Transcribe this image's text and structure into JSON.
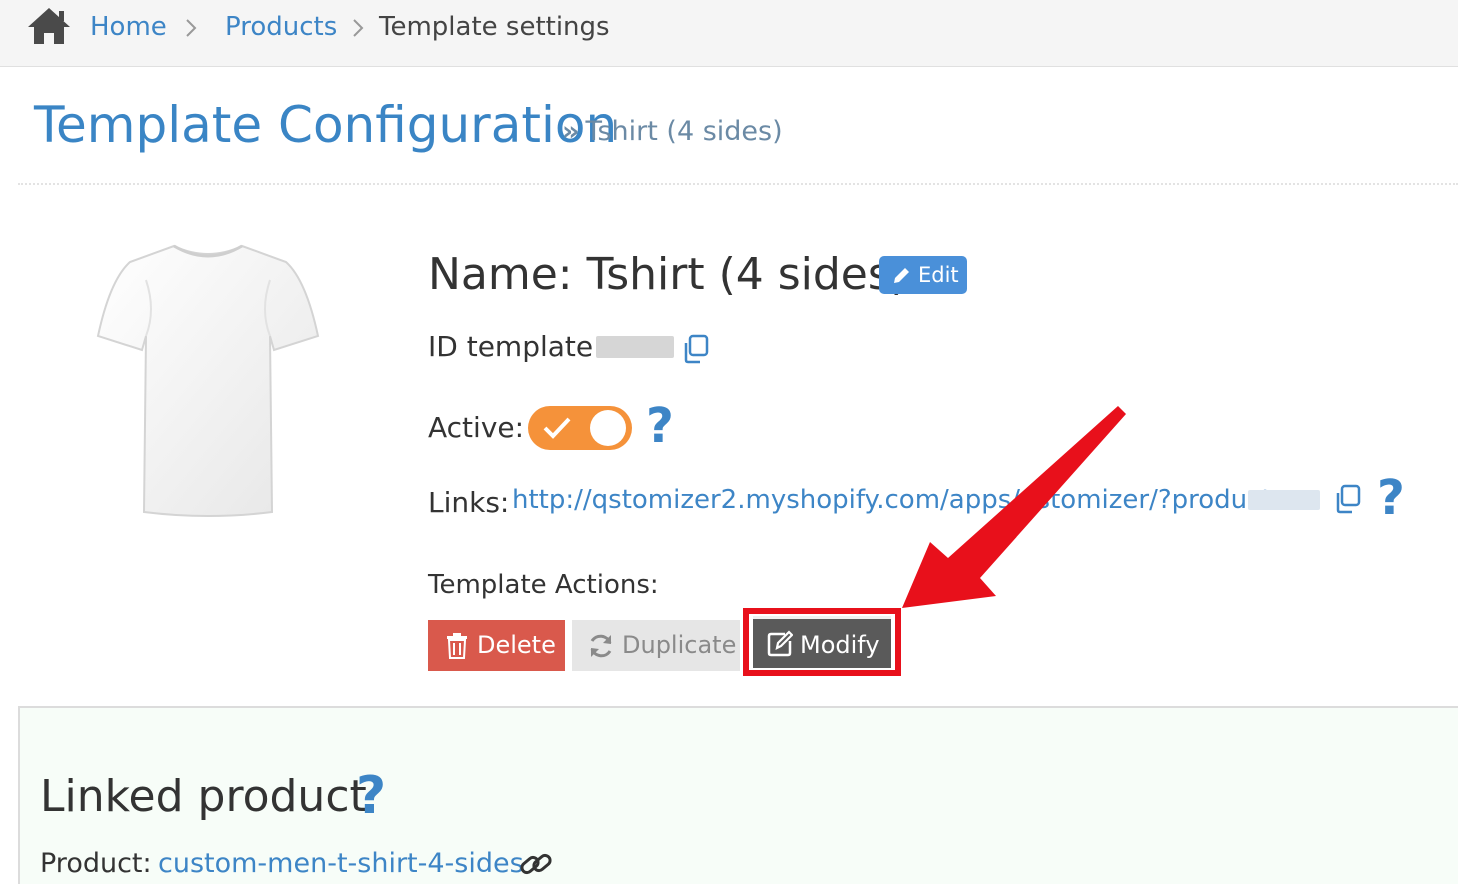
{
  "breadcrumb": {
    "items": [
      "Home",
      "Products"
    ],
    "current": "Template settings"
  },
  "header": {
    "title": "Template Configuration",
    "subtitle": "Tshirt (4 sides)",
    "subtitle_prefix": "»"
  },
  "template": {
    "name_line": "Name: Tshirt (4 sides)",
    "edit_label": "Edit",
    "id_label": "ID template:",
    "active_label": "Active:",
    "active_on": true,
    "links_label": "Links:",
    "link_url": "http://qstomizer2.myshopify.com/apps/qstomizer/?product=",
    "actions_label": "Template Actions:",
    "actions": {
      "delete": "Delete",
      "duplicate": "Duplicate",
      "modify": "Modify"
    }
  },
  "linked": {
    "title": "Linked product",
    "product_label": "Product:",
    "product_link": "custom-men-t-shirt-4-sides"
  },
  "help_symbol": "?",
  "colors": {
    "link": "#3d85c6",
    "toggle_on": "#f5923a",
    "delete": "#d9594c",
    "modify": "#5a5a5a",
    "highlight": "#e8101b"
  }
}
